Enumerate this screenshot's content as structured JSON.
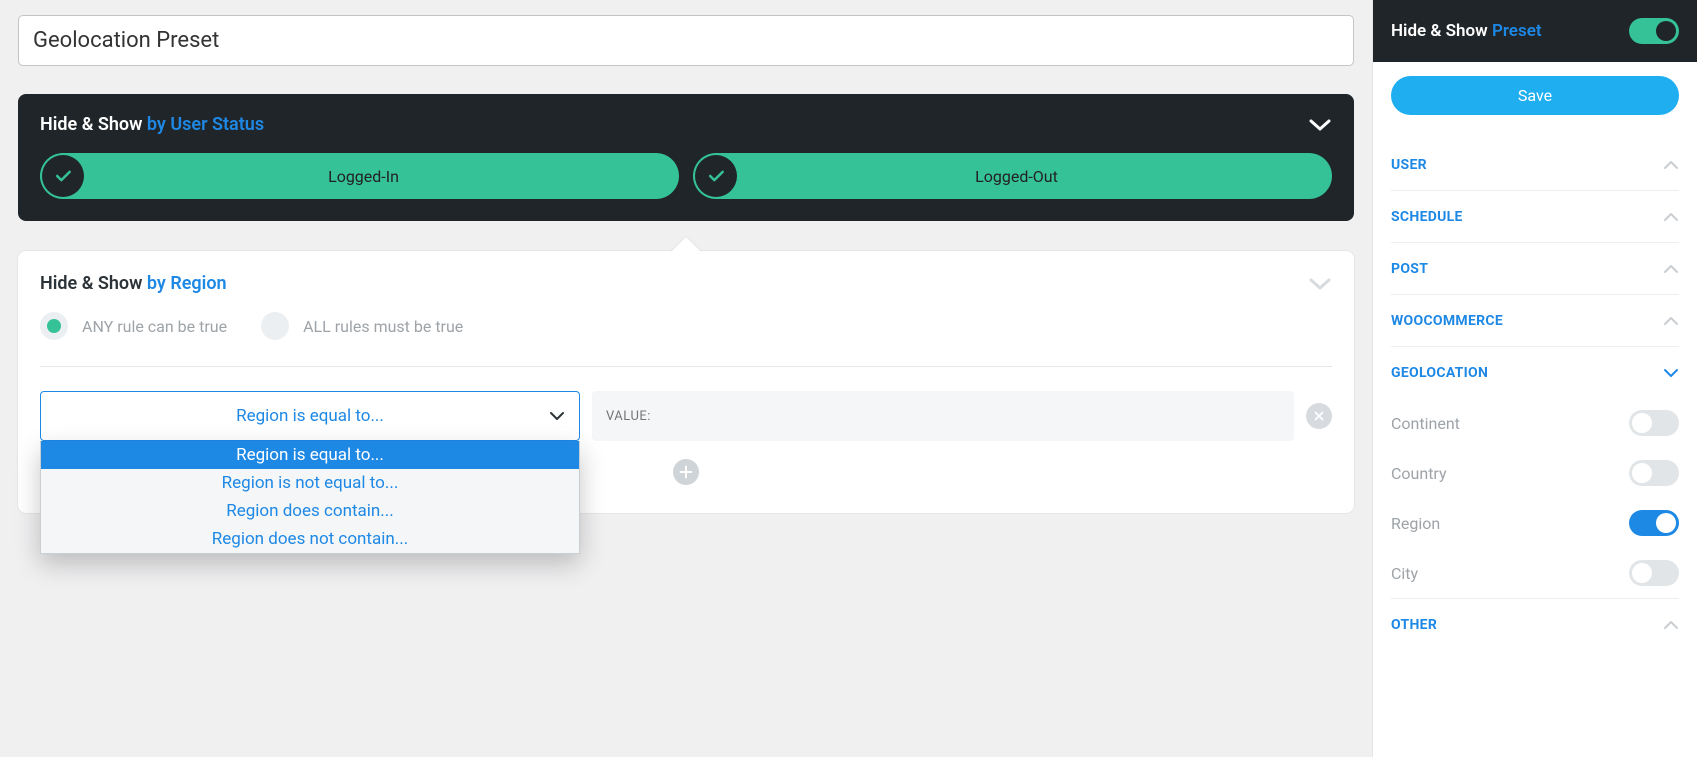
{
  "preset_name": "Geolocation Preset",
  "user_status_panel": {
    "title_prefix": "Hide & Show",
    "title_suffix": "by User Status",
    "options": [
      "Logged-In",
      "Logged-Out"
    ]
  },
  "region_panel": {
    "title_prefix": "Hide & Show",
    "title_suffix": "by Region",
    "mode_any": "ANY rule can be true",
    "mode_all": "ALL rules must be true",
    "select_current": "Region is equal to...",
    "value_placeholder": "VALUE:",
    "dropdown": [
      "Region is equal to...",
      "Region is not equal to...",
      "Region does contain...",
      "Region does not contain..."
    ]
  },
  "sidebar": {
    "title_prefix": "Hide & Show",
    "title_suffix": "Preset",
    "save": "Save",
    "sections": {
      "user": "USER",
      "schedule": "SCHEDULE",
      "post": "POST",
      "woocommerce": "WOOCOMMERCE",
      "geolocation": "GEOLOCATION",
      "other": "OTHER"
    },
    "geo_items": {
      "continent": "Continent",
      "country": "Country",
      "region": "Region",
      "city": "City"
    }
  }
}
